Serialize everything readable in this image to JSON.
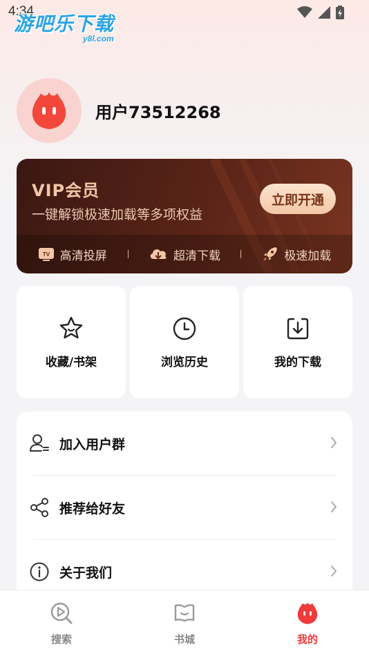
{
  "status_bar": {
    "time": "4:34"
  },
  "watermark": {
    "main": "游吧乐下载",
    "sub": "y8l.com"
  },
  "profile": {
    "username": "用户73512268"
  },
  "vip": {
    "title": "VIP会员",
    "subtitle": "一键解锁极速加载等多项权益",
    "button_label": "立即开通",
    "features": [
      {
        "label": "高清投屏",
        "icon": "tv-icon"
      },
      {
        "label": "超清下载",
        "icon": "cloud-download-icon"
      },
      {
        "label": "极速加载",
        "icon": "rocket-icon"
      }
    ]
  },
  "quick_actions": [
    {
      "label": "收藏/书架",
      "icon": "star-icon"
    },
    {
      "label": "浏览历史",
      "icon": "clock-icon"
    },
    {
      "label": "我的下载",
      "icon": "download-icon"
    }
  ],
  "menu": [
    {
      "label": "加入用户群",
      "icon": "user-group-icon"
    },
    {
      "label": "推荐给好友",
      "icon": "share-icon"
    },
    {
      "label": "关于我们",
      "icon": "info-icon"
    }
  ],
  "bottom_nav": [
    {
      "label": "搜索",
      "icon": "play-search-icon",
      "active": false
    },
    {
      "label": "书城",
      "icon": "book-icon",
      "active": false
    },
    {
      "label": "我的",
      "icon": "flame-mascot-icon",
      "active": true
    }
  ],
  "colors": {
    "accent": "#ee3b3b",
    "vip_gold": "#f3c6a6",
    "vip_bg": "#4a1f15"
  }
}
